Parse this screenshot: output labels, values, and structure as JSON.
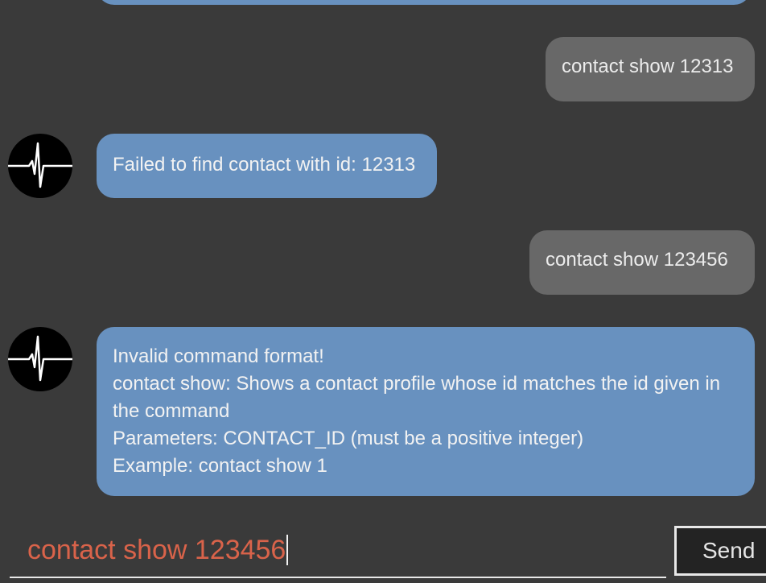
{
  "messages": [
    {
      "role": "bot",
      "lines": []
    },
    {
      "role": "user",
      "text": "contact show 12313"
    },
    {
      "role": "bot",
      "lines": [
        "Failed to find contact with id: 12313"
      ]
    },
    {
      "role": "user",
      "text": "contact show 123456"
    },
    {
      "role": "bot",
      "lines": [
        "Invalid command format!",
        "contact show: Shows a contact profile whose id matches the id given in",
        "the command",
        "Parameters: CONTACT_ID (must be a positive integer)",
        "Example: contact show 1"
      ]
    }
  ],
  "input": {
    "value": "contact show 123456",
    "text_color": "#d9634a"
  },
  "send_button": {
    "label": "Send"
  },
  "avatar": {
    "icon": "heartbeat-icon"
  },
  "colors": {
    "background": "#3a3a3a",
    "bot_bubble": "#6891bf",
    "user_bubble": "#686868"
  }
}
